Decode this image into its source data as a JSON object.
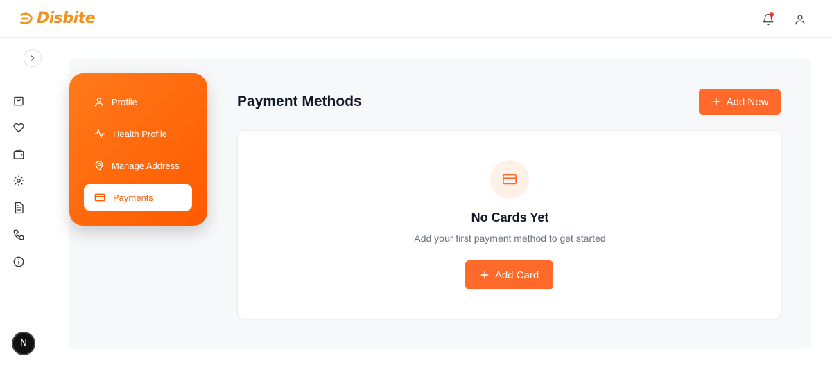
{
  "app": {
    "logo_text": "Disbite"
  },
  "header": {
    "notification_icon": "bell-icon",
    "account_icon": "user-icon"
  },
  "sidebar": {
    "items": [
      {
        "icon": "shopping-bag-icon"
      },
      {
        "icon": "heart-icon"
      },
      {
        "icon": "wallet-icon"
      },
      {
        "icon": "settings-icon"
      },
      {
        "icon": "document-icon"
      },
      {
        "icon": "phone-icon"
      },
      {
        "icon": "info-icon"
      }
    ],
    "badge": "N"
  },
  "account_menu": {
    "items": [
      {
        "label": "Profile",
        "icon": "user-icon"
      },
      {
        "label": "Health Profile",
        "icon": "activity-icon"
      },
      {
        "label": "Manage Address",
        "icon": "map-pin-icon"
      },
      {
        "label": "Payments",
        "icon": "credit-card-icon",
        "active": true
      }
    ]
  },
  "main": {
    "title": "Payment Methods",
    "add_new_label": "Add New",
    "empty_state": {
      "title": "No Cards Yet",
      "subtitle": "Add your first payment method to get started",
      "button_label": "Add Card"
    }
  },
  "colors": {
    "accent": "#ff6a2a",
    "brand": "#f0921e",
    "panel_bg": "#f7f8fa"
  }
}
